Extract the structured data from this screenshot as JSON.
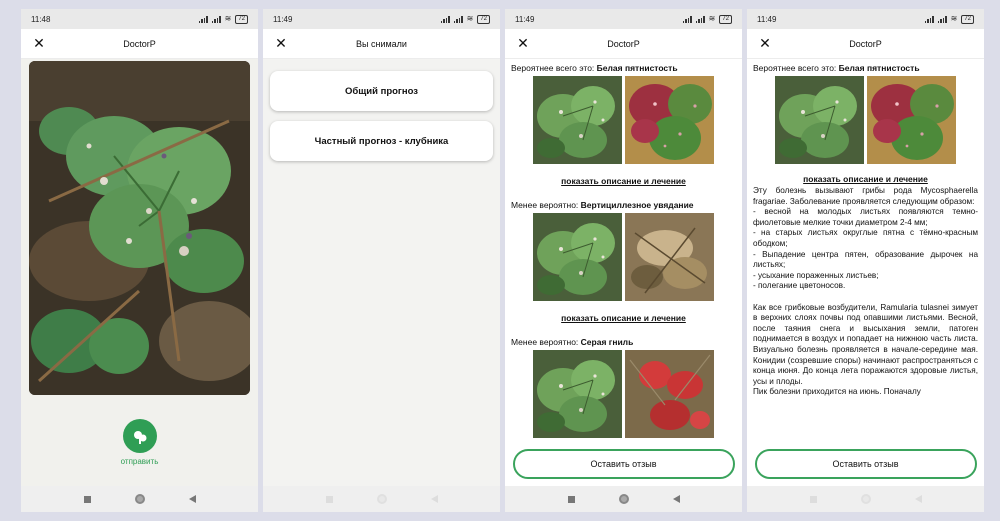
{
  "status_bar": {
    "time_1": "11:48",
    "time_2": "11:49",
    "time_3": "11:49",
    "time_4": "11:49",
    "battery": "72"
  },
  "screen1": {
    "title": "DoctorP",
    "send_label": "отправить"
  },
  "screen2": {
    "title": "Вы снимали",
    "options": [
      "Общий прогноз",
      "Частный прогноз - клубника"
    ]
  },
  "screen3": {
    "title": "DoctorP",
    "results": [
      {
        "prefix": "Вероятнее всего это:",
        "disease": "Белая пятнистость",
        "link": "показать описание и лечение"
      },
      {
        "prefix": "Менее вероятно:",
        "disease": "Вертициллезное увядание",
        "link": "показать описание и лечение"
      },
      {
        "prefix": "Менее вероятно:",
        "disease": "Серая гниль"
      }
    ],
    "feedback_button": "Оставить отзыв"
  },
  "screen4": {
    "title": "DoctorP",
    "prefix": "Вероятнее всего это:",
    "disease": "Белая пятнистость",
    "link": "показать описание и лечение",
    "description": "Эту болезнь вызывают грибы рода Mycosphaerella fragariae. Заболевание проявляется следующим образом:\n- весной на молодых листьях появляются темно-фиолетовые мелкие точки диаметром 2-4 мм;\n- на старых листьях округлые пятна с тёмно-красным ободком;\n- Выпадение центра пятен, образование дырочек на листьях;\n- усыхание пораженных листьев;\n- полегание цветоносов.\n\nКак все грибковые возбудители, Ramularia tulasnei зимует в верхних слоях почвы под опавшими листьями. Весной, после таяния снега и высыхания земли, патоген поднимается в воздух и попадает на нижнюю часть листа. Визуально болезнь проявляется в начале-середине мая. Конидии (созревшие споры) начинают распространяться с конца июня. До конца лета поражаются здоровые листья, усы и плоды.\nПик болезни приходится на июнь. Поначалу",
    "feedback_button": "Оставить отзыв"
  },
  "colors": {
    "accent": "#2f9e55",
    "button_border": "#3aa35c",
    "frame": "#dcdde9"
  },
  "icons": {
    "close": "close-icon",
    "send": "plant-upload-icon"
  }
}
